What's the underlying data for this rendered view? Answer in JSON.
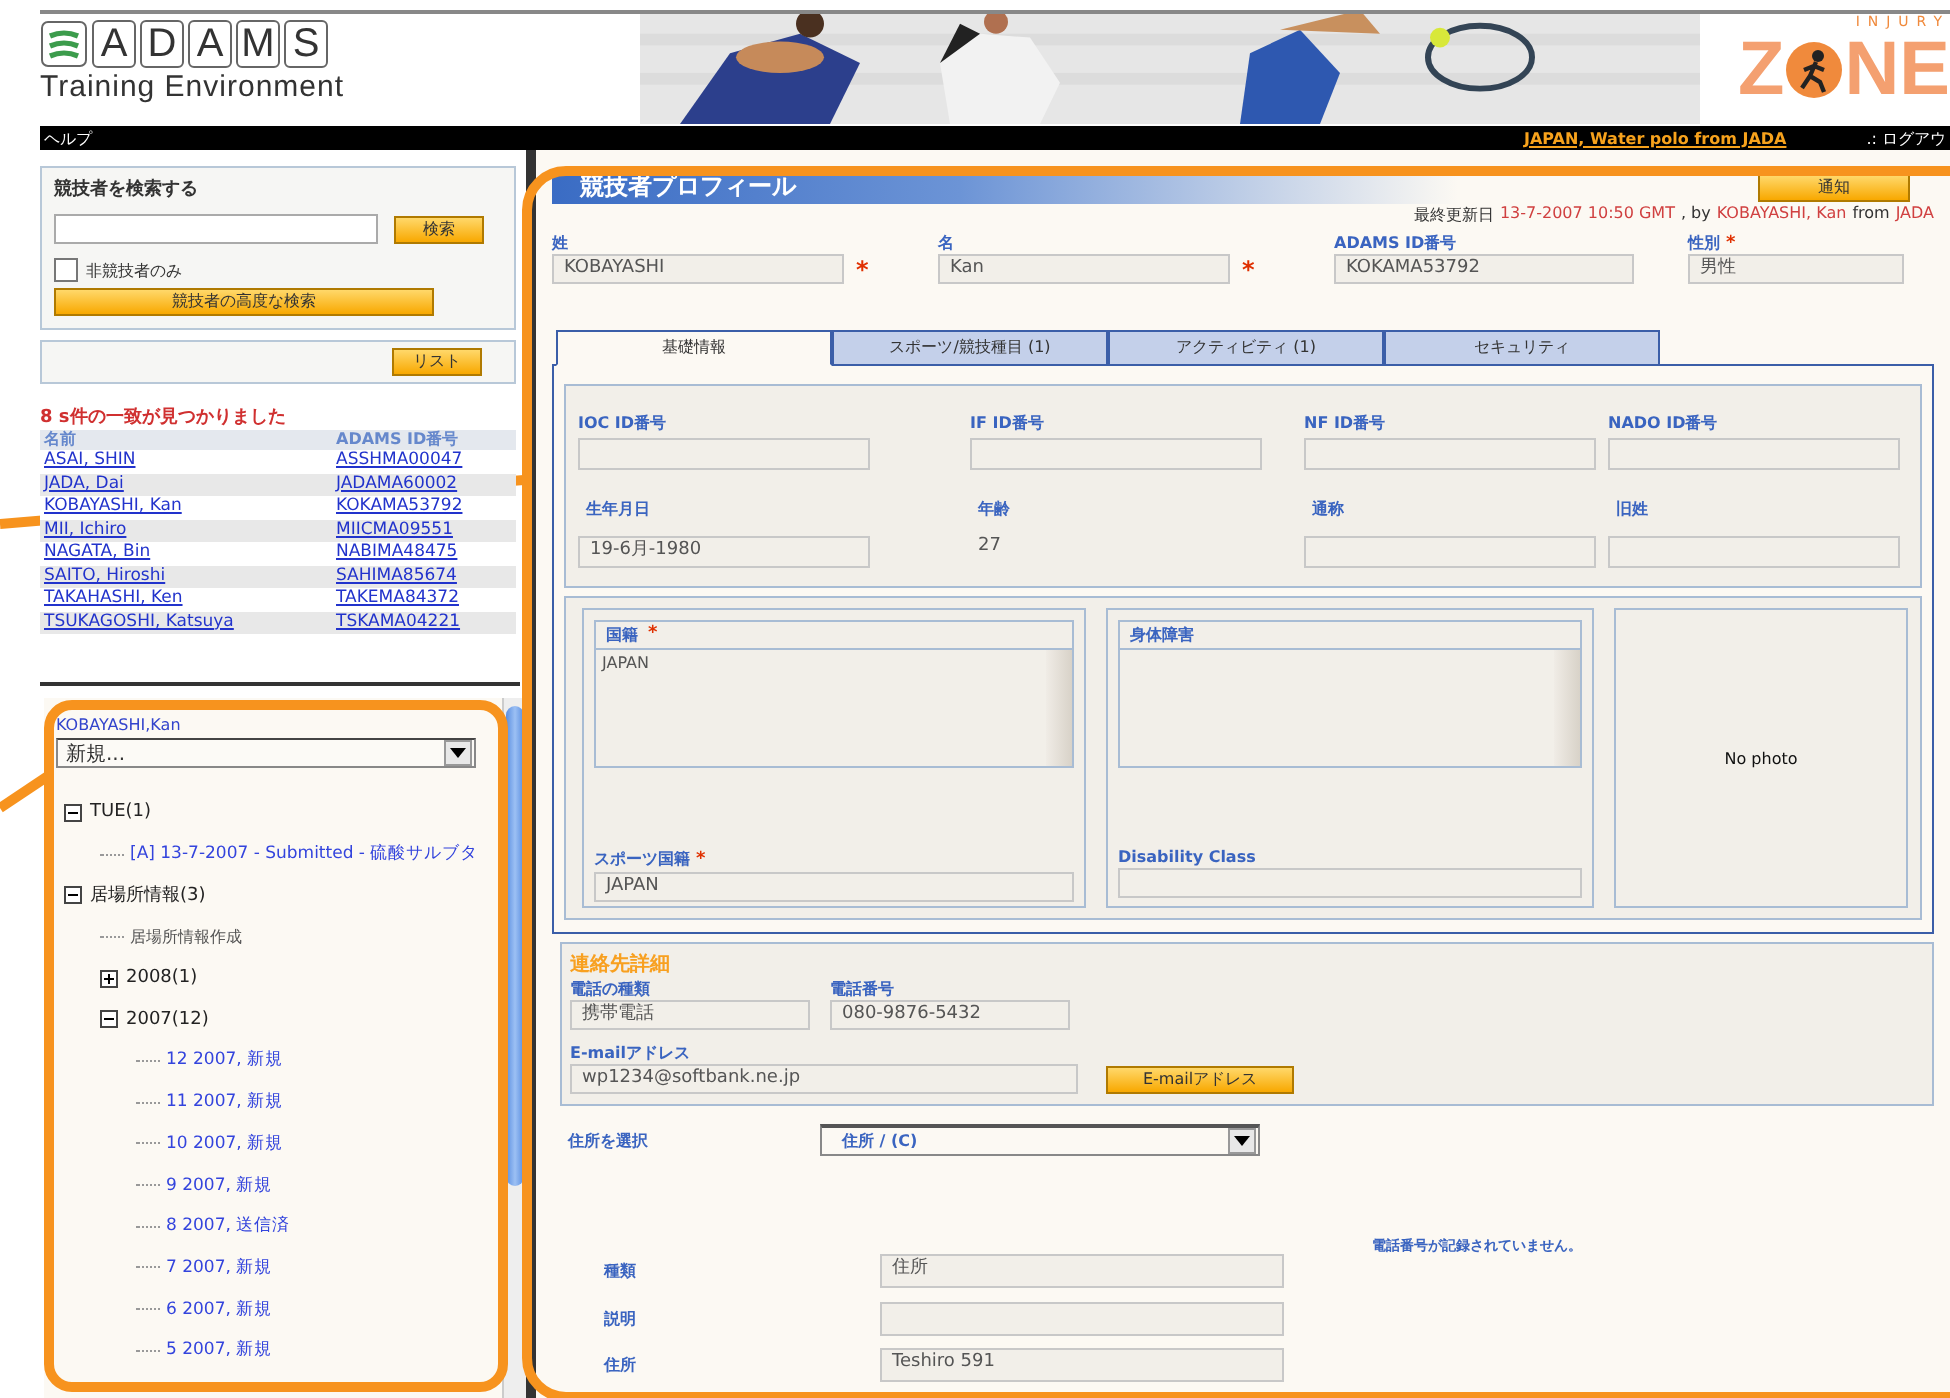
{
  "header": {
    "logo_letters": [
      "A",
      "D",
      "A",
      "M",
      "S"
    ],
    "logo_subtitle": "Training Environment",
    "zone_logo": {
      "top": "INJURY",
      "left": "Z",
      "right": "NE"
    }
  },
  "menu_bar": {
    "help": "ヘルプ",
    "context": "JAPAN,  Water polo  from  JADA",
    "logout": ".: ログアウ"
  },
  "search": {
    "title": "競技者を検索する",
    "search_button": "検索",
    "non_athlete": {
      "label": "非競技者のみ",
      "checked": false
    },
    "advanced_button": "競技者の高度な検索",
    "list_button": "リスト"
  },
  "results": {
    "summary": "8 s件の一致が見つかりました",
    "columns": [
      "名前",
      "ADAMS ID番号"
    ],
    "rows": [
      {
        "name": "ASAI, SHIN",
        "id": "ASSHMA00047"
      },
      {
        "name": "JADA, Dai",
        "id": "JADAMA60002"
      },
      {
        "name": "KOBAYASHI, Kan",
        "id": "KOKAMA53792"
      },
      {
        "name": "MII, Ichiro",
        "id": "MIICMA09551"
      },
      {
        "name": "NAGATA, Bin",
        "id": "NABIMA48475"
      },
      {
        "name": "SAITO, Hiroshi",
        "id": "SAHIMA85674"
      },
      {
        "name": "TAKAHASHI, Ken",
        "id": "TAKEMA84372"
      },
      {
        "name": "TSUKAGOSHI, Katsuya",
        "id": "TSKAMA04221"
      }
    ]
  },
  "tree_panel": {
    "athlete": "KOBAYASHI,Kan",
    "new_select": "新規...",
    "tree": [
      {
        "label": "TUE(1)",
        "kind": "folder",
        "expanded": true,
        "children": [
          {
            "label": "[A] 13-7-2007 - Submitted - 硫酸サルブタ",
            "kind": "link"
          }
        ]
      },
      {
        "label": "居場所情報(3)",
        "kind": "folder",
        "expanded": true,
        "children": [
          {
            "label": "居場所情報作成",
            "kind": "text"
          },
          {
            "label": "2008(1)",
            "kind": "folder",
            "expanded": false
          },
          {
            "label": "2007(12)",
            "kind": "folder",
            "expanded": true,
            "children": [
              {
                "label": "12 2007, 新規",
                "kind": "link"
              },
              {
                "label": "11 2007, 新規",
                "kind": "link"
              },
              {
                "label": "10 2007, 新規",
                "kind": "link"
              },
              {
                "label": "9 2007, 新規",
                "kind": "link"
              },
              {
                "label": "8 2007, 送信済",
                "kind": "link"
              },
              {
                "label": "7 2007, 新規",
                "kind": "link"
              },
              {
                "label": "6 2007, 新規",
                "kind": "link"
              },
              {
                "label": "5 2007, 新規",
                "kind": "link"
              }
            ]
          }
        ]
      }
    ]
  },
  "profile": {
    "title": "競技者プロフィール",
    "notify_button": "通知",
    "last_updated": {
      "prefix": "最終更新日",
      "date": "13-7-2007 10:50 GMT",
      "by": ", by",
      "user": "KOBAYASHI, Kan",
      "from": "from",
      "org": "JADA"
    },
    "top_fields": [
      {
        "label": "姓",
        "value": "KOBAYASHI",
        "required_mark": "*"
      },
      {
        "label": "名",
        "value": "Kan",
        "required_mark": "*"
      },
      {
        "label": "ADAMS ID番号",
        "value": "KOKAMA53792"
      },
      {
        "label": "性別",
        "value": "男性",
        "label_required_mark": "*"
      }
    ],
    "tabs": [
      {
        "label": "基礎情報",
        "selected": true
      },
      {
        "label": "スポーツ/競技種目 (1)",
        "selected": false
      },
      {
        "label": "アクティビティ (1)",
        "selected": false
      },
      {
        "label": "セキュリティ",
        "selected": false
      }
    ],
    "id_fields": [
      {
        "label": "IOC ID番号",
        "kind": "input"
      },
      {
        "label": "IF ID番号",
        "kind": "input"
      },
      {
        "label": "NF ID番号",
        "kind": "input"
      },
      {
        "label": "NADO ID番号",
        "kind": "input"
      },
      {
        "label": "生年月日",
        "kind": "input",
        "value": "19-6月-1980"
      },
      {
        "label": "年齢",
        "kind": "text",
        "value": "27"
      },
      {
        "label": "通称",
        "kind": "input"
      },
      {
        "label": "旧姓",
        "kind": "input"
      }
    ],
    "nationality": {
      "label": "国籍",
      "required_mark": "*",
      "items": [
        "JAPAN"
      ],
      "sport_label": "スポーツ国籍",
      "sport_required_mark": "*",
      "sport_value": "JAPAN"
    },
    "disability": {
      "label": "身体障害",
      "class_label": "Disability Class"
    },
    "photo": "No photo",
    "contact": {
      "title": "連絡先詳細",
      "phone_type_label": "電話の種類",
      "phone_type": "携帯電話",
      "phone_label": "電話番号",
      "phone": "080-9876-5432",
      "email_label": "E-mailアドレス",
      "email": "wp1234@softbank.ne.jp",
      "email_button": "E-mailアドレス"
    },
    "address": {
      "select_label": "住所を選択",
      "select_value": "住所 / (C)",
      "rows": [
        {
          "label": "種類",
          "value": "住所"
        },
        {
          "label": "説明"
        },
        {
          "label": "住所",
          "value": "Teshiro 591"
        }
      ],
      "no_phone": "電話番号が記録されていません。"
    }
  }
}
